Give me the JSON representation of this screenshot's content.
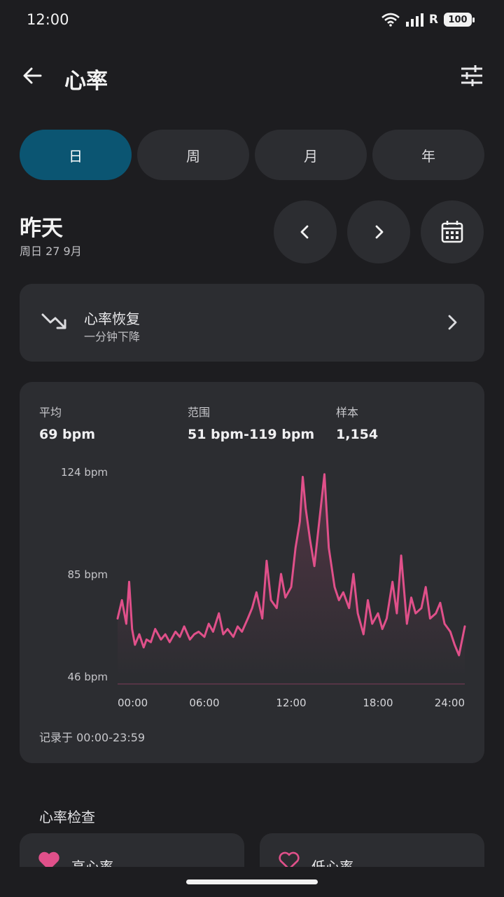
{
  "status_bar": {
    "time": "12:00",
    "battery": "100",
    "network": "R"
  },
  "header": {
    "title": "心率",
    "back_icon": "arrow-left-icon",
    "filter_icon": "sliders-icon"
  },
  "tabs": [
    {
      "label": "日",
      "active": true
    },
    {
      "label": "周",
      "active": false
    },
    {
      "label": "月",
      "active": false
    },
    {
      "label": "年",
      "active": false
    }
  ],
  "date": {
    "title": "昨天",
    "subtitle": "周日 27 9月"
  },
  "recovery": {
    "title": "心率恢复",
    "subtitle": "一分钟下降",
    "icon": "trending-down-icon"
  },
  "stats": [
    {
      "label": "平均",
      "value": "69 bpm"
    },
    {
      "label": "范围",
      "value": "51 bpm-119 bpm"
    },
    {
      "label": "样本",
      "value": "1,154"
    }
  ],
  "chart_data": {
    "type": "line",
    "y_tick_labels": [
      "124 bpm",
      "85 bpm",
      "46 bpm"
    ],
    "y_ticks": [
      124,
      85,
      46
    ],
    "ylim": [
      46,
      124
    ],
    "x_tick_labels": [
      "00:00",
      "06:00",
      "12:00",
      "18:00",
      "24:00"
    ],
    "xlim": [
      0,
      24
    ],
    "line_color": "#e0508a",
    "series": [
      {
        "x": [
          0,
          0.3,
          0.6,
          0.8,
          1.0,
          1.2,
          1.5,
          1.8,
          2.0,
          2.3,
          2.6,
          3.0,
          3.3,
          3.6,
          4.0,
          4.3,
          4.6,
          5.0,
          5.3,
          5.6,
          6.0,
          6.3,
          6.6,
          7.0,
          7.3,
          7.6,
          8.0,
          8.3,
          8.6,
          9.0,
          9.3,
          9.6,
          10.0,
          10.3,
          10.6,
          11.0,
          11.3,
          11.6,
          12.0,
          12.3,
          12.6,
          12.8,
          13.0,
          13.3,
          13.6,
          14.0,
          14.3,
          14.6,
          15.0,
          15.3,
          15.6,
          16.0,
          16.3,
          16.6,
          17.0,
          17.3,
          17.6,
          18.0,
          18.3,
          18.6,
          19.0,
          19.3,
          19.6,
          20.0,
          20.3,
          20.6,
          21.0,
          21.3,
          21.6,
          22.0,
          22.3,
          22.6,
          23.0,
          23.3,
          23.6,
          24.0
        ],
        "y": [
          68,
          75,
          66,
          82,
          64,
          58,
          62,
          57,
          60,
          59,
          64,
          60,
          62,
          59,
          63,
          61,
          65,
          60,
          62,
          63,
          61,
          66,
          63,
          70,
          62,
          64,
          61,
          65,
          63,
          68,
          72,
          78,
          68,
          90,
          75,
          72,
          85,
          76,
          80,
          95,
          105,
          122,
          110,
          98,
          88,
          108,
          123,
          95,
          80,
          75,
          78,
          72,
          85,
          70,
          62,
          75,
          66,
          70,
          64,
          68,
          82,
          70,
          92,
          66,
          76,
          70,
          72,
          80,
          68,
          70,
          74,
          66,
          63,
          58,
          54,
          65
        ]
      }
    ]
  },
  "footnote": "记录于 00:00-23:59",
  "section": {
    "title": "心率检查"
  },
  "checks": [
    {
      "label": "高心率",
      "icon": "heart-filled-icon"
    },
    {
      "label": "低心率",
      "icon": "heart-outline-icon"
    }
  ],
  "colors": {
    "accent": "#0b5572",
    "chart": "#e0508a",
    "card": "#2c2d31",
    "background": "#1d1d20"
  }
}
